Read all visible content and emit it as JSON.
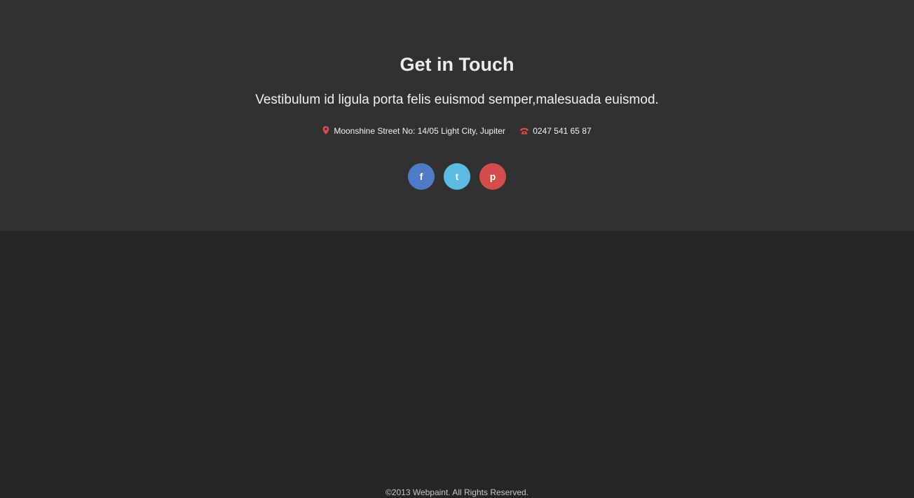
{
  "contact": {
    "title": "Get in Touch",
    "tagline": "Vestibulum id ligula porta felis euismod semper,malesuada euismod.",
    "address": {
      "icon": "map-marker-icon",
      "text": "Moonshine Street No: 14/05 Light City, Jupiter"
    },
    "phone": {
      "icon": "phone-icon",
      "text": "0247 541 65 87"
    },
    "accent_color": "#e24b4b"
  },
  "socials": [
    {
      "name": "facebook",
      "icon": "facebook-icon",
      "glyph": "f",
      "color": "#4f7ac7"
    },
    {
      "name": "tumblr",
      "icon": "tumblr-icon",
      "glyph": "t",
      "color": "#5bbbe1"
    },
    {
      "name": "pinterest",
      "icon": "pinterest-icon",
      "glyph": "p",
      "color": "#d54c4c"
    }
  ],
  "footer": {
    "copyright": "©2013 Webpaint. All Rights Reserved."
  }
}
